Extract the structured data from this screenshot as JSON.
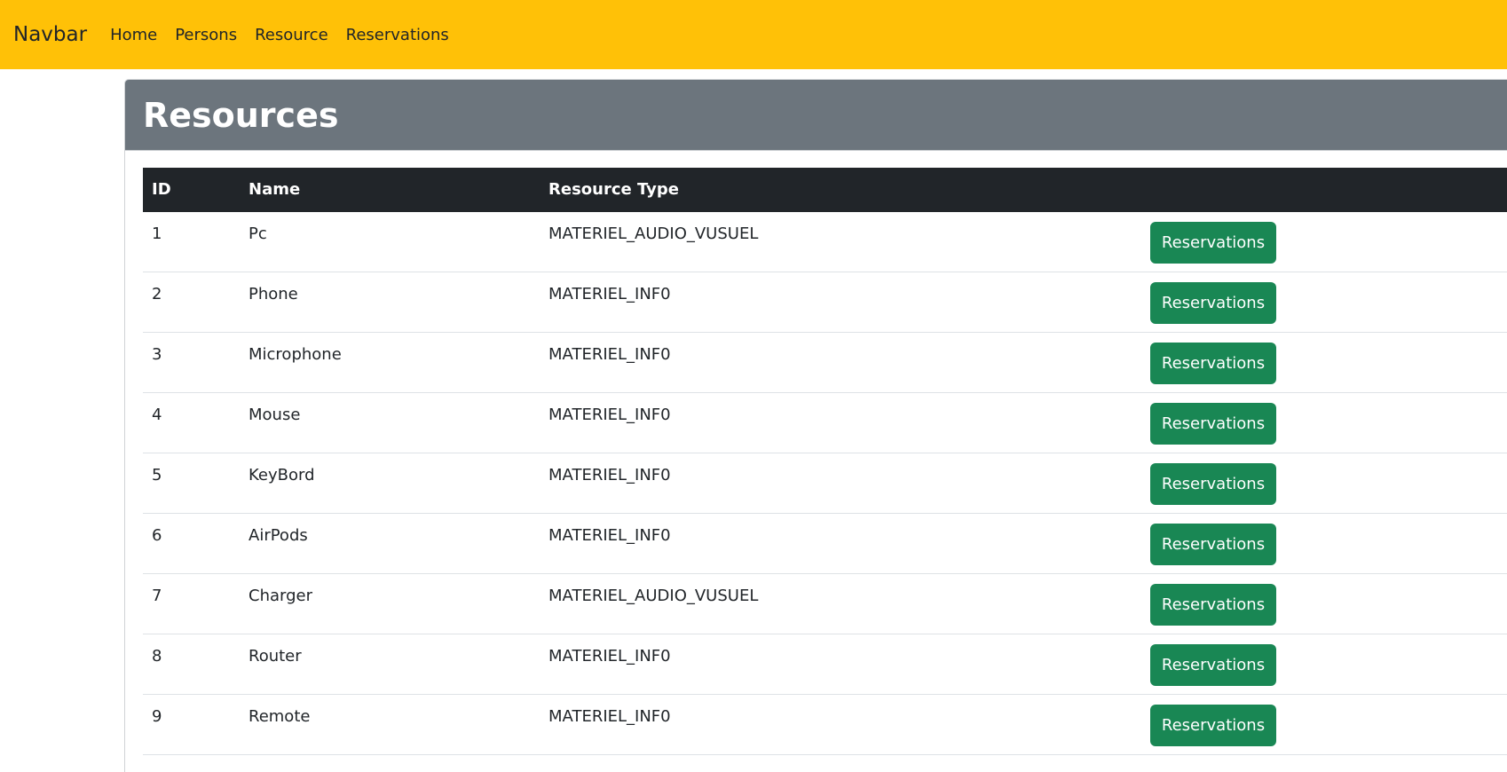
{
  "navbar": {
    "brand": "Navbar",
    "links": [
      "Home",
      "Persons",
      "Resource",
      "Reservations"
    ],
    "color": "#ffc107"
  },
  "page": {
    "title": "Resources"
  },
  "table": {
    "headers": [
      "ID",
      "Name",
      "Resource Type"
    ],
    "rows": [
      {
        "id": "1",
        "name": "Pc",
        "type": "MATERIEL_AUDIO_VUSUEL",
        "action": "Reservations"
      },
      {
        "id": "2",
        "name": "Phone",
        "type": "MATERIEL_INF0",
        "action": "Reservations"
      },
      {
        "id": "3",
        "name": "Microphone",
        "type": "MATERIEL_INF0",
        "action": "Reservations"
      },
      {
        "id": "4",
        "name": "Mouse",
        "type": "MATERIEL_INF0",
        "action": "Reservations"
      },
      {
        "id": "5",
        "name": "KeyBord",
        "type": "MATERIEL_INF0",
        "action": "Reservations"
      },
      {
        "id": "6",
        "name": "AirPods",
        "type": "MATERIEL_INF0",
        "action": "Reservations"
      },
      {
        "id": "7",
        "name": "Charger",
        "type": "MATERIEL_AUDIO_VUSUEL",
        "action": "Reservations"
      },
      {
        "id": "8",
        "name": "Router",
        "type": "MATERIEL_INF0",
        "action": "Reservations"
      },
      {
        "id": "9",
        "name": "Remote",
        "type": "MATERIEL_INF0",
        "action": "Reservations"
      }
    ],
    "button_color": "#198754"
  }
}
